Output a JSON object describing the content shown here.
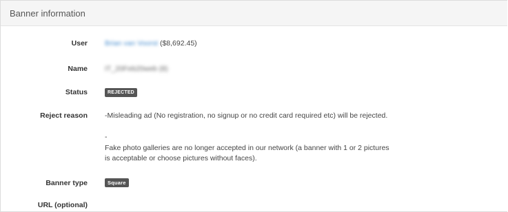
{
  "panel": {
    "title": "Banner information"
  },
  "fields": {
    "user": {
      "label": "User",
      "name": "Brian van Voorst",
      "balance": "($8,692.45)"
    },
    "name": {
      "label": "Name",
      "value": "IT_20Feb20web (8)"
    },
    "status": {
      "label": "Status",
      "badge": "REJECTED"
    },
    "reject_reason": {
      "label": "Reject reason",
      "line1": "-Misleading ad (No registration, no signup or no credit card required etc) will be rejected.",
      "dash": "-",
      "line2": "Fake photo galleries are no longer accepted in our network (a banner with 1 or 2 pictures",
      "line3": "is acceptable or choose  pictures without faces)."
    },
    "banner_type": {
      "label": "Banner type",
      "badge": "Square"
    },
    "url": {
      "label": "URL (optional)"
    }
  }
}
